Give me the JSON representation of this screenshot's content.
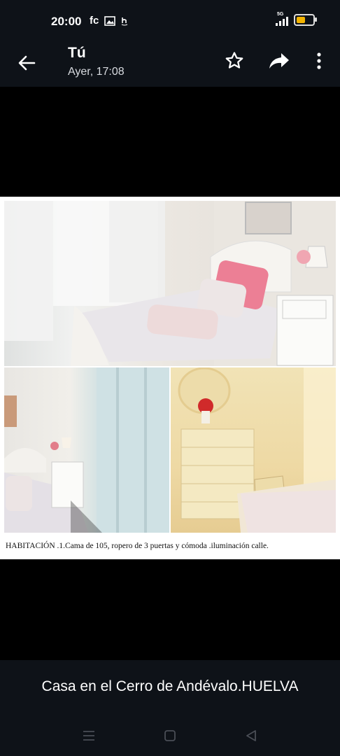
{
  "status_bar": {
    "time": "20:00",
    "app_icon_text": "fc",
    "network": "5G"
  },
  "header": {
    "title": "Tú",
    "subtitle": "Ayer, 17:08"
  },
  "icons": {
    "back": "arrow-left-icon",
    "star": "star-icon",
    "share": "share-icon",
    "more": "more-vert-icon",
    "nav_recents": "menu-icon",
    "nav_home": "square-icon",
    "nav_back": "triangle-back-icon"
  },
  "photo": {
    "caption": "HABITACIÓN .1.Cama de 105, ropero de 3 puertas y cómoda .iluminación calle."
  },
  "message": {
    "text": "Casa en el Cerro de Andévalo.HUELVA"
  },
  "colors": {
    "bar_background": "#0e1218",
    "battery": "#f4b400"
  }
}
